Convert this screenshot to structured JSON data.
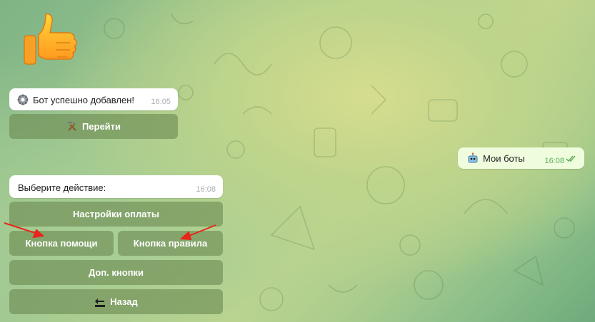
{
  "chat": {
    "sticker_icon": "thumbs-up-icon",
    "bot_added": {
      "icon": "gear-icon",
      "text": "Бот успешно добавлен!",
      "time": "16:05",
      "button": {
        "icon": "hammer-pick-icon",
        "label": "Перейти"
      }
    },
    "outgoing": {
      "icon": "robot-icon",
      "text": "Мои боты",
      "time": "16:08",
      "status": "read-double-check"
    },
    "menu": {
      "text": "Выберите действие:",
      "time": "16:08",
      "buttons": {
        "payment": "Настройки оплаты",
        "help": "Кнопка помощи",
        "rules": "Кнопка правила",
        "extra": "Доп. кнопки",
        "back": {
          "icon": "back-arrow-icon",
          "label": "Назад"
        }
      }
    }
  },
  "colors": {
    "button_bg": "#6c8a52",
    "outgoing_bubble": "#effdde",
    "annotation_arrow": "#e8261b"
  }
}
